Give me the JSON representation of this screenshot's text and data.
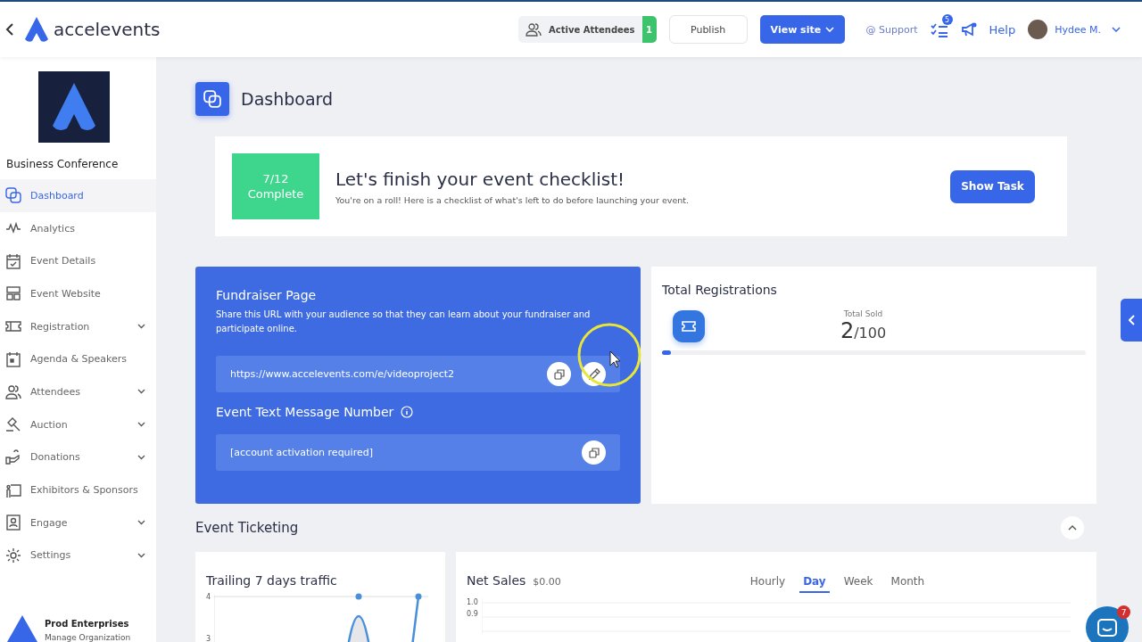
{
  "header": {
    "brand": "accelevents",
    "active_attendees": {
      "label": "Active Attendees",
      "count": "1"
    },
    "publish": "Publish",
    "view_site": "View site",
    "support": "@ Support",
    "tasks_badge": "5",
    "help": "Help",
    "user": "Hydee M."
  },
  "sidebar": {
    "event_name": "Business Conference",
    "items": [
      {
        "label": "Dashboard",
        "selected": true,
        "expandable": false
      },
      {
        "label": "Analytics",
        "selected": false,
        "expandable": false
      },
      {
        "label": "Event Details",
        "selected": false,
        "expandable": false
      },
      {
        "label": "Event Website",
        "selected": false,
        "expandable": false
      },
      {
        "label": "Registration",
        "selected": false,
        "expandable": true
      },
      {
        "label": "Agenda & Speakers",
        "selected": false,
        "expandable": false
      },
      {
        "label": "Attendees",
        "selected": false,
        "expandable": true
      },
      {
        "label": "Auction",
        "selected": false,
        "expandable": true
      },
      {
        "label": "Donations",
        "selected": false,
        "expandable": true
      },
      {
        "label": "Exhibitors & Sponsors",
        "selected": false,
        "expandable": false
      },
      {
        "label": "Engage",
        "selected": false,
        "expandable": true
      },
      {
        "label": "Settings",
        "selected": false,
        "expandable": true
      }
    ],
    "org": {
      "name": "Prod Enterprises",
      "link": "Manage Organization"
    }
  },
  "page_title": "Dashboard",
  "checklist": {
    "progress": "7/12",
    "progress_label": "Complete",
    "title": "Let's finish your event checklist!",
    "subtitle": "You're on a roll! Here is a checklist of what's left to do before launching your event.",
    "button": "Show Task"
  },
  "fundraiser": {
    "title": "Fundraiser Page",
    "description": "Share this URL with your audience so that they can learn about your fundraiser and participate online.",
    "url": "https://www.accelevents.com/e/videoproject2",
    "sms_title": "Event Text Message Number",
    "sms_value": "[account activation required]"
  },
  "registrations": {
    "title": "Total Registrations",
    "sold_label": "Total Sold",
    "sold": "2",
    "total": "/100",
    "level": 0.02
  },
  "ticketing": {
    "title": "Event Ticketing",
    "traffic": {
      "title": "Trailing 7 days traffic",
      "y_tick_labels": [
        "4",
        "3"
      ]
    },
    "net_sales": {
      "title": "Net Sales",
      "amount": "$0.00",
      "y_tick_labels": [
        "1.0",
        "0.9"
      ],
      "tabs": [
        {
          "label": "Hourly",
          "selected": false
        },
        {
          "label": "Day",
          "selected": true
        },
        {
          "label": "Week",
          "selected": false
        },
        {
          "label": "Month",
          "selected": false
        }
      ]
    }
  },
  "chat_badge": "7"
}
